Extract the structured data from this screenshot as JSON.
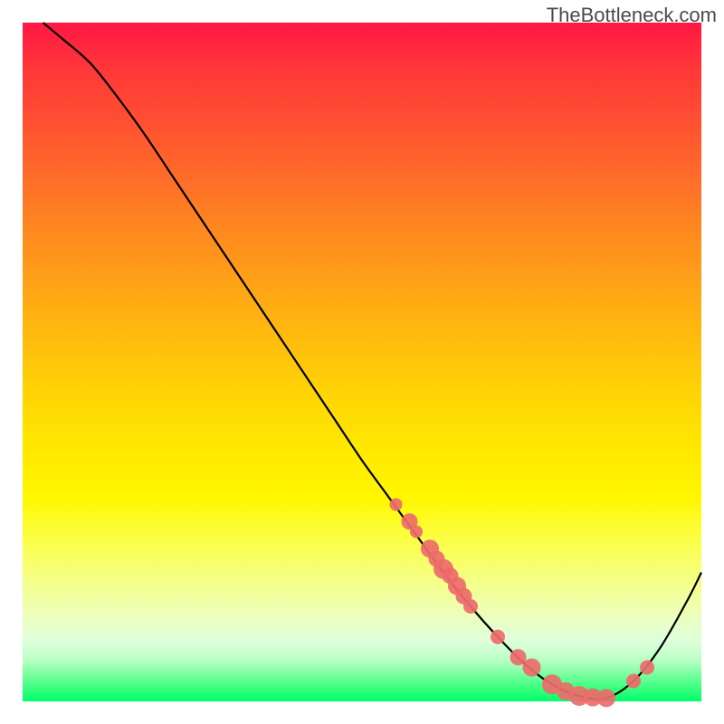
{
  "watermark": "TheBottleneck.com",
  "chart_data": {
    "type": "line",
    "title": "",
    "xlabel": "",
    "ylabel": "",
    "xlim": [
      0,
      100
    ],
    "ylim": [
      0,
      100
    ],
    "grid": false,
    "series": [
      {
        "name": "bottleneck-curve",
        "x": [
          3,
          6,
          10,
          14,
          18,
          22,
          26,
          30,
          34,
          38,
          42,
          46,
          50,
          54,
          58,
          62,
          66,
          70,
          74,
          78,
          82,
          86,
          90,
          94,
          98,
          100
        ],
        "y": [
          100,
          97.5,
          94,
          89,
          83.5,
          77.5,
          71.5,
          65.5,
          59.5,
          53.5,
          47.5,
          41.5,
          35.5,
          30,
          24.5,
          19,
          14,
          9.5,
          5.5,
          2.5,
          0.8,
          0.5,
          3,
          8,
          15,
          19
        ]
      }
    ],
    "markers": {
      "name": "highlighted-points",
      "x": [
        55,
        57,
        58,
        60,
        61,
        62,
        63,
        64,
        65,
        66,
        70,
        73,
        75,
        78,
        80,
        82,
        84,
        86,
        90,
        92
      ],
      "y": [
        29,
        26.5,
        25,
        22.5,
        21,
        19.5,
        18.5,
        17,
        15.5,
        14,
        9.5,
        6.5,
        5,
        2.5,
        1.5,
        0.8,
        0.6,
        0.5,
        3,
        5
      ],
      "r": [
        7,
        9,
        7,
        10,
        9,
        11,
        9,
        10,
        9,
        8,
        8,
        9,
        10,
        11,
        10,
        11,
        10,
        10,
        8,
        8
      ]
    },
    "gradient_stops": [
      {
        "pos": 0,
        "color": "#ff1744"
      },
      {
        "pos": 50,
        "color": "#ffd000"
      },
      {
        "pos": 80,
        "color": "#fbff44"
      },
      {
        "pos": 100,
        "color": "#00ff6a"
      }
    ]
  }
}
